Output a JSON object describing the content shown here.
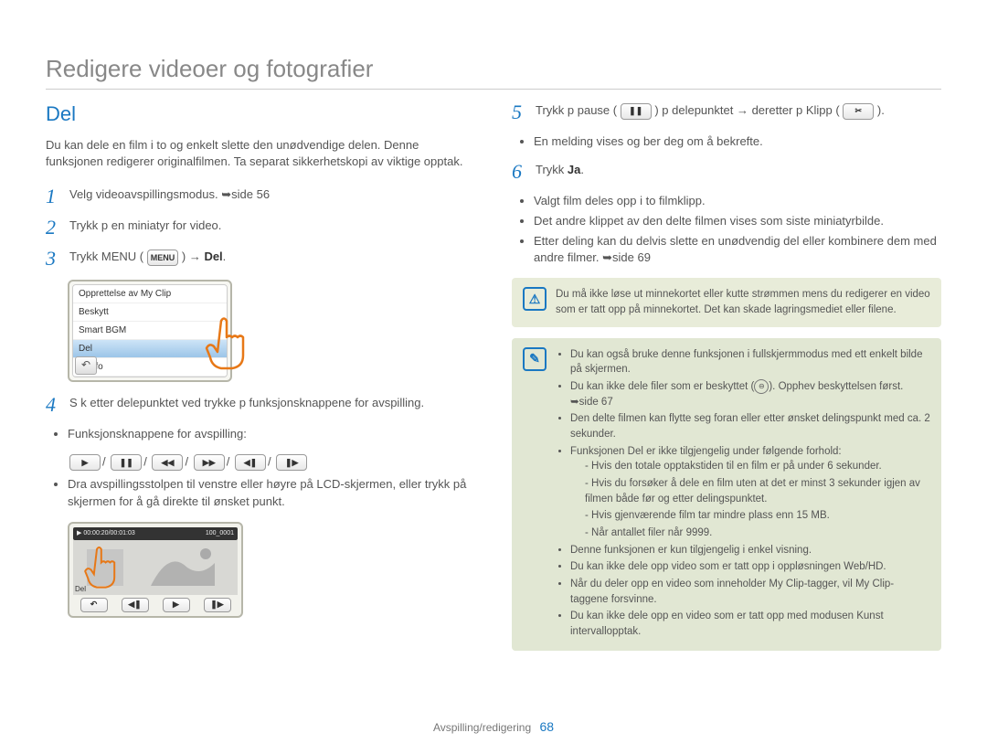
{
  "page_title": "Redigere videoer og fotografier",
  "section_title": "Del",
  "intro": "Du kan dele en film i to og enkelt slette den unødvendige delen. Denne funksjonen redigerer originalfilmen. Ta separat sikkerhetskopi av viktige opptak.",
  "steps": {
    "s1": {
      "text": "Velg videoavspillingsmodus.",
      "ref": "➥side 56"
    },
    "s2": {
      "text": "Trykk p  en miniatyr for video."
    },
    "s3": {
      "pre": "Trykk MENU (",
      "menu": "MENU",
      "post": ") → ",
      "bold": "Del",
      "tail": "."
    },
    "s4": {
      "text": "S k etter delepunktet ved  trykke p  funksjonsknappene for avspilling."
    },
    "s5": {
      "pre": "Trykk p  pause ( ",
      "pauseHint": "❚❚",
      "mid": " ) p  delepunktet → deretter p  Klipp ( ",
      "cutHint": "✂",
      "post": " )."
    },
    "s6": {
      "pre": "Trykk ",
      "bold": "Ja",
      "post": "."
    }
  },
  "menu_items": [
    "Opprettelse av My Clip",
    "Beskytt",
    "Smart BGM",
    "Del",
    "Filinfo"
  ],
  "s4_bullets": {
    "lead": "Funksjonsknappene for avspilling:",
    "row_icons": [
      "▶",
      "❚❚",
      "◀◀",
      "▶▶",
      "◀❚",
      "❚▶"
    ],
    "b2": "Dra avspillingsstolpen til venstre eller høyre på LCD-skjermen, eller trykk på skjermen for å gå direkte til ønsket punkt."
  },
  "player": {
    "time": "00:00:20/00:01:03",
    "file": "100_0001",
    "label": "Del",
    "ctrls": [
      "↶",
      "◀❚",
      "▶",
      "❚▶"
    ]
  },
  "s5_bullets": {
    "b1": "En melding vises og ber deg om å bekrefte."
  },
  "s6_bullets": {
    "b1": "Valgt film deles opp i to filmklipp.",
    "b2": "Det andre klippet av den delte filmen vises som siste miniatyrbilde.",
    "b3": "Etter deling kan du delvis slette en unødvendig del eller kombinere dem med andre filmer. ➥side 69"
  },
  "note1": "Du må ikke løse ut minnekortet eller kutte strømmen mens du redigerer en video som er tatt opp på minnekortet. Det kan skade lagringsmediet eller filene.",
  "note2": {
    "i1": "Du kan også bruke denne funksjonen i fullskjermmodus med ett enkelt bilde på skjermen.",
    "i2_pre": "Du kan ikke dele filer som er beskyttet (",
    "i2_post": "). Opphev beskyttelsen først. ➥side 67",
    "i3": "Den delte filmen kan flytte seg foran eller etter ønsket delingspunkt med ca. 2 sekunder.",
    "i4": "Funksjonen Del er ikke tilgjengelig under følgende forhold:",
    "i4a": "Hvis den totale opptakstiden til en film er på under 6 sekunder.",
    "i4b": "Hvis du forsøker å dele en film uten at det er minst 3 sekunder igjen av filmen både før og etter delingspunktet.",
    "i4c": "Hvis gjenværende film tar mindre plass enn 15 MB.",
    "i4d": "Når antallet filer når 9999.",
    "i5": "Denne funksjonen er kun tilgjengelig i enkel visning.",
    "i6": "Du kan ikke dele opp video som er tatt opp i oppløsningen Web/HD.",
    "i7": "Når du deler opp en video som inneholder My Clip-tagger, vil My Clip-taggene forsvinne.",
    "i8": "Du kan ikke dele opp en video som er tatt opp med modusen Kunst intervallopptak."
  },
  "footer": {
    "label": "Avspilling/redigering",
    "page": "68"
  }
}
